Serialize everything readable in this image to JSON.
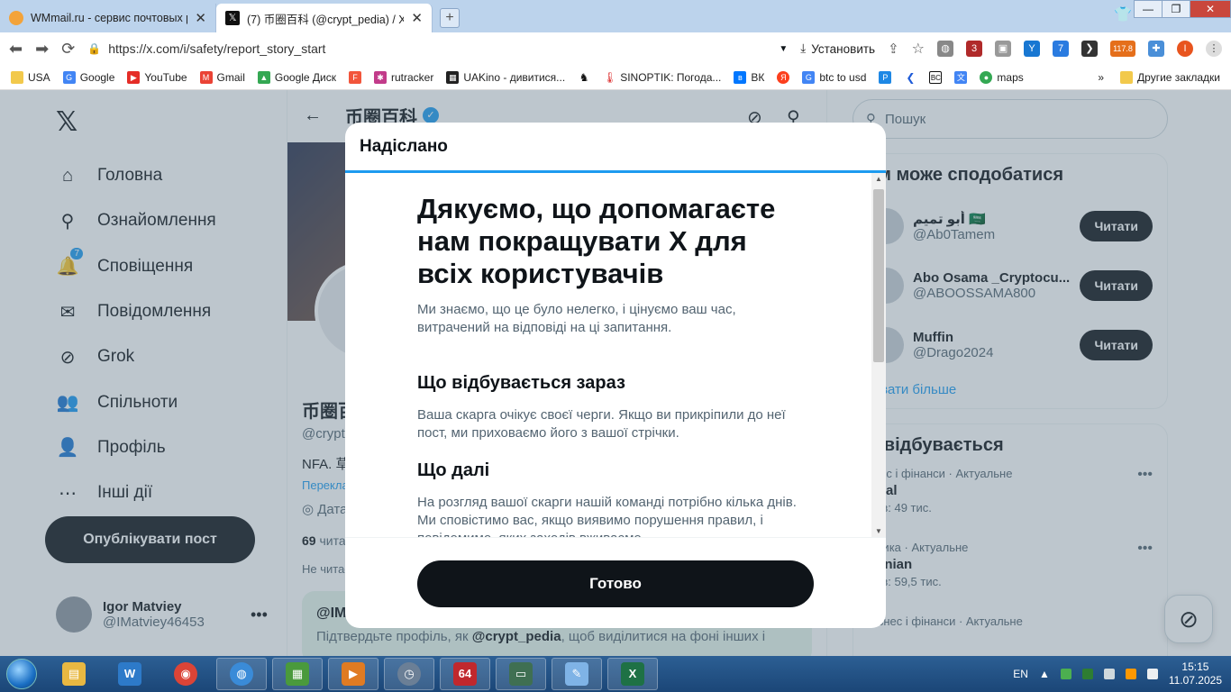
{
  "browser": {
    "tabs": [
      {
        "title": "WMmail.ru - сервис почтовых рас",
        "active": false
      },
      {
        "title": "(7) 币圈百科 (@crypt_pedia) / X",
        "active": true
      }
    ],
    "url": "https://x.com/i/safety/report_story_start",
    "install_label": "Установить",
    "ext_badges": {
      "red": "3",
      "blue": "7",
      "price": "117.8"
    },
    "profile_initial": "I",
    "bookmarks": [
      "USA",
      "Google",
      "YouTube",
      "Gmail",
      "Google Диск",
      "rutracker",
      "UAKino - дивитися...",
      "SINOPTIK: Погода...",
      "ВК",
      "btc to usd",
      "maps"
    ],
    "bookmarks_more": "»",
    "other_bookmarks": "Другие закладки"
  },
  "x": {
    "nav": [
      {
        "label": "Головна",
        "icon": "home-icon",
        "glyph": "⌂"
      },
      {
        "label": "Ознайомлення",
        "icon": "search-icon",
        "glyph": "⚲"
      },
      {
        "label": "Сповіщення",
        "icon": "bell-icon",
        "glyph": "🔔",
        "badge": "7"
      },
      {
        "label": "Повідомлення",
        "icon": "mail-icon",
        "glyph": "✉"
      },
      {
        "label": "Grok",
        "icon": "grok-icon",
        "glyph": "⊘"
      },
      {
        "label": "Спільноти",
        "icon": "people-icon",
        "glyph": "👥"
      },
      {
        "label": "Профіль",
        "icon": "person-icon",
        "glyph": "👤"
      },
      {
        "label": "Інші дії",
        "icon": "more-icon",
        "glyph": "⋯"
      }
    ],
    "post_button": "Опублікувати пост",
    "me": {
      "name": "Igor Matviey",
      "handle": "@IMatviey46453"
    },
    "profile": {
      "name": "币圈百科",
      "name_partial": "币圈百",
      "handle_partial": "@crypt",
      "bio_partial": "NFA. 草",
      "translate_partial": "Перекла",
      "date_partial": "Дата",
      "following_count": "69",
      "following_partial": "чита",
      "not_following_partial": "Не читає",
      "verify_title_partial": "@IM",
      "verify_text_prefix": "Підтвердьте профіль, як ",
      "verify_text_handle": "@crypt_pedia",
      "verify_text_suffix": ", щоб виділитися на фоні інших і"
    },
    "search_placeholder": "Пошук",
    "suggestions_title": "ам може сподобатися",
    "suggestions": [
      {
        "name": "أبو تميم 🇸🇦",
        "handle": "@Ab0Tamem",
        "button": "Читати"
      },
      {
        "name": "Abo Osama _Cryptocu...",
        "handle": "@ABOOSSAMA800",
        "button": "Читати"
      },
      {
        "name": "Muffin",
        "handle": "@Drago2024",
        "button": "Читати"
      }
    ],
    "show_more": "казати більше",
    "trends_title": "о відбувається",
    "trends": [
      {
        "category": "знес і фінанси · Актуальне",
        "title": "rtual",
        "count": "стів: 49 тис."
      },
      {
        "category": "літика · Актуальне",
        "title": "rainian",
        "count": "стів: 59,5 тис."
      },
      {
        "category": "Бізнес і фінанси · Актуальне",
        "title": "",
        "count": ""
      }
    ]
  },
  "modal": {
    "header": "Надіслано",
    "title": "Дякуємо, що допомагаєте нам покращувати X для всіх користувачів",
    "subtitle": "Ми знаємо, що це було нелегко, і цінуємо ваш час, витрачений на відповіді на ці запитання.",
    "section1_title": "Що відбувається зараз",
    "section1_text": "Ваша скарга очікує своєї черги. Якщо ви прикріпили до неї пост, ми приховаємо його з вашої стрічки.",
    "section2_title": "Що далі",
    "section2_text": "На розгляд вашої скарги нашій команді потрібно кілька днів. Ми сповістимо вас, якщо виявимо порушення правил, і повідомимо, яких заходів вживаємо.",
    "done_button": "Готово"
  },
  "taskbar": {
    "lang": "EN",
    "time": "15:15",
    "date": "11.07.2025",
    "app_64_label": "64"
  }
}
